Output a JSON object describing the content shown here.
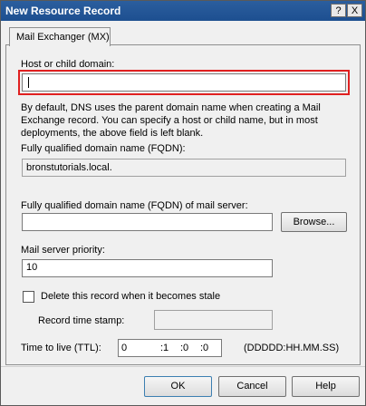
{
  "window": {
    "title": "New Resource Record",
    "help_glyph": "?",
    "close_glyph": "X"
  },
  "tab": {
    "label": "Mail Exchanger (MX)"
  },
  "host": {
    "label": "Host or child domain:",
    "value": "",
    "description": "By default, DNS uses the parent domain name when creating a Mail Exchange record. You can specify a host or child name, but in most deployments, the above field is left blank."
  },
  "fqdn": {
    "label": "Fully qualified domain name (FQDN):",
    "value": "bronstutorials.local."
  },
  "mail_server": {
    "label": "Fully qualified domain name (FQDN) of mail server:",
    "value": "",
    "browse_label": "Browse..."
  },
  "priority": {
    "label": "Mail server priority:",
    "value": "10"
  },
  "stale": {
    "label": "Delete this record when it becomes stale",
    "checked": false
  },
  "timestamp": {
    "label": "Record time stamp:",
    "value": ""
  },
  "ttl": {
    "label": "Time to live (TTL):",
    "days": "0",
    "hours": ":1",
    "minutes": ":0",
    "seconds": ":0",
    "format_hint": "(DDDDD:HH.MM.SS)"
  },
  "buttons": {
    "ok": "OK",
    "cancel": "Cancel",
    "help": "Help"
  },
  "colors": {
    "titlebar": "#1d4f90",
    "highlight": "#e02020"
  }
}
